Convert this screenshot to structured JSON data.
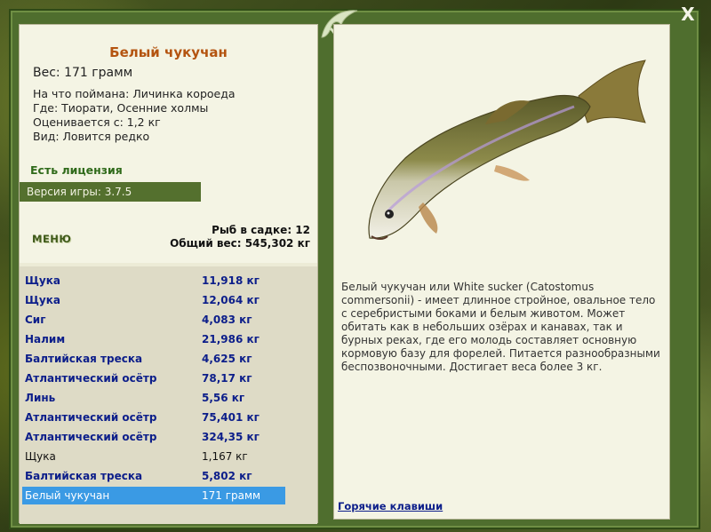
{
  "window": {
    "close_label": "X"
  },
  "fish": {
    "name": "Белый чукучан",
    "weight_line": "Вес: 171 грамм",
    "bait_line": "На что поймана: Личинка короеда",
    "place_line": "Где: Тиорати, Осенние холмы",
    "value_line": "Оценивается с: 1,2 кг",
    "kind_line": "Вид: Ловится редко",
    "description": "Белый чукучан или White sucker (Catostomus commersonii) - имеет длинное стройное, овальное тело с серебристыми боками и белым животом. Может обитать как в небольших озёрах и канавах, так и бурных реках, где его молодь составляет основную кормовую базу для форелей. Питается разнообразными беспозвоночными. Достигает веса более 3 кг."
  },
  "license": "Есть лицензия",
  "version": "Версия игры: 3.7.5",
  "menu_label": "МЕНЮ",
  "stats": {
    "fish_in_cage": "Рыб в садке: 12",
    "total_weight": "Общий вес: 545,302 кг"
  },
  "catch": [
    {
      "name": "Щука",
      "weight": "11,918 кг",
      "style": "bold"
    },
    {
      "name": "Щука",
      "weight": "12,064 кг",
      "style": "bold"
    },
    {
      "name": "Сиг",
      "weight": "4,083 кг",
      "style": "bold"
    },
    {
      "name": "Налим",
      "weight": "21,986 кг",
      "style": "bold"
    },
    {
      "name": "Балтийская треска",
      "weight": "4,625 кг",
      "style": "bold"
    },
    {
      "name": "Атлантический осётр",
      "weight": "78,17 кг",
      "style": "bold"
    },
    {
      "name": "Линь",
      "weight": "5,56 кг",
      "style": "bold"
    },
    {
      "name": "Атлантический осётр",
      "weight": "75,401 кг",
      "style": "bold"
    },
    {
      "name": "Атлантический осётр",
      "weight": "324,35 кг",
      "style": "bold"
    },
    {
      "name": "Щука",
      "weight": "1,167 кг",
      "style": "normal"
    },
    {
      "name": "Балтийская треска",
      "weight": "5,802 кг",
      "style": "bold"
    },
    {
      "name": "Белый чукучан",
      "weight": "171 грамм",
      "style": "selected"
    }
  ],
  "hotkeys_label": "Горячие клавиши",
  "colors": {
    "selected": "#3a9ae4",
    "title": "#b45410",
    "link": "#0c1e8a",
    "panel_green": "#54702e"
  }
}
